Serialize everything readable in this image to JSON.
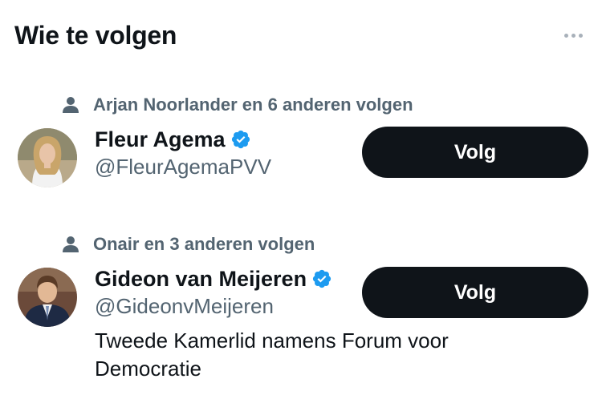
{
  "header": {
    "title": "Wie te volgen",
    "more_icon": "more-horizontal-icon"
  },
  "suggestions": [
    {
      "social_context": "Arjan Noorlander en 6 anderen volgen",
      "social_icon": "person-icon",
      "name": "Fleur Agema",
      "verified": true,
      "handle": "@FleurAgemaPVV",
      "bio": "",
      "follow_label": "Volg"
    },
    {
      "social_context": "Onair en 3 anderen volgen",
      "social_icon": "person-icon",
      "name": "Gideon van Meijeren",
      "verified": true,
      "handle": "@GideonvMeijeren",
      "bio": "Tweede Kamerlid namens Forum voor Democratie",
      "follow_label": "Volg"
    }
  ],
  "colors": {
    "text_primary": "#0f1419",
    "text_secondary": "#536471",
    "verified_blue": "#1d9bf0",
    "button_bg": "#0f1419",
    "button_text": "#ffffff"
  }
}
